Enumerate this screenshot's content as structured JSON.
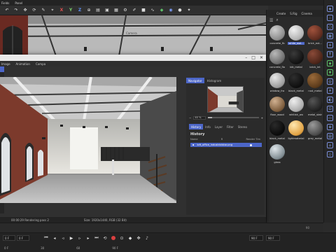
{
  "menubar": {
    "items": [
      "Fields",
      "Panel"
    ]
  },
  "toolbar": {
    "icons": [
      "undo-icon",
      "redo-icon",
      "move-icon",
      "pen-icon",
      "X",
      "Y",
      "Z",
      "snap-icon",
      "clapper-icon",
      "render-icon",
      "picture-viewer-icon",
      "cube-icon",
      "sphere-icon",
      "light-icon"
    ],
    "x_label": "X",
    "y_label": "Y",
    "z_label": "Z"
  },
  "viewport": {
    "camera_label": "Camera"
  },
  "material_panel": {
    "tabs": [
      "Create",
      "S.Rig",
      "Cinema"
    ],
    "materials": [
      {
        "name": "concrete_fb"
      },
      {
        "name": "white_wal..."
      },
      {
        "name": "brick_ext..."
      },
      {
        "name": "concrete_flo"
      },
      {
        "name": "blk_metal"
      },
      {
        "name": "brick_int"
      },
      {
        "name": "window_fra"
      },
      {
        "name": "black_metal"
      },
      {
        "name": "rust_metal"
      },
      {
        "name": "floor_wood"
      },
      {
        "name": "whitish_wo"
      },
      {
        "name": "metal_stair"
      },
      {
        "name": "black_metal"
      },
      {
        "name": "lightmaterial"
      },
      {
        "name": "grey_metal"
      },
      {
        "name": "glass"
      }
    ],
    "selected_index": 1
  },
  "picture_viewer": {
    "menu": [
      "Image",
      "Animation",
      "Compa"
    ],
    "side_tabs": [
      "Navigator",
      "Histogram"
    ],
    "zoom_value": "40 %",
    "zoom_fraction": 0.08,
    "history_tabs": [
      "History",
      "Info",
      "Layer",
      "Filter",
      "Stereo"
    ],
    "history_title": "History",
    "history_head": {
      "name": "Name",
      "render": "R",
      "render_time": "Render Tim"
    },
    "history_row": "loft_office_industrialstar.png",
    "status": {
      "time": "00:00:29 Rendering pass 2",
      "size": "Size: 1920x1440, RGB (32 Bit)"
    }
  },
  "timeline": {
    "ticks": [
      "90",
      "90 F"
    ]
  },
  "playbar": {
    "start": "0 F",
    "current": "0 F",
    "end": "90 F",
    "end2": "90 F",
    "row2": [
      "0 F",
      "30",
      "60",
      "90 F"
    ]
  }
}
